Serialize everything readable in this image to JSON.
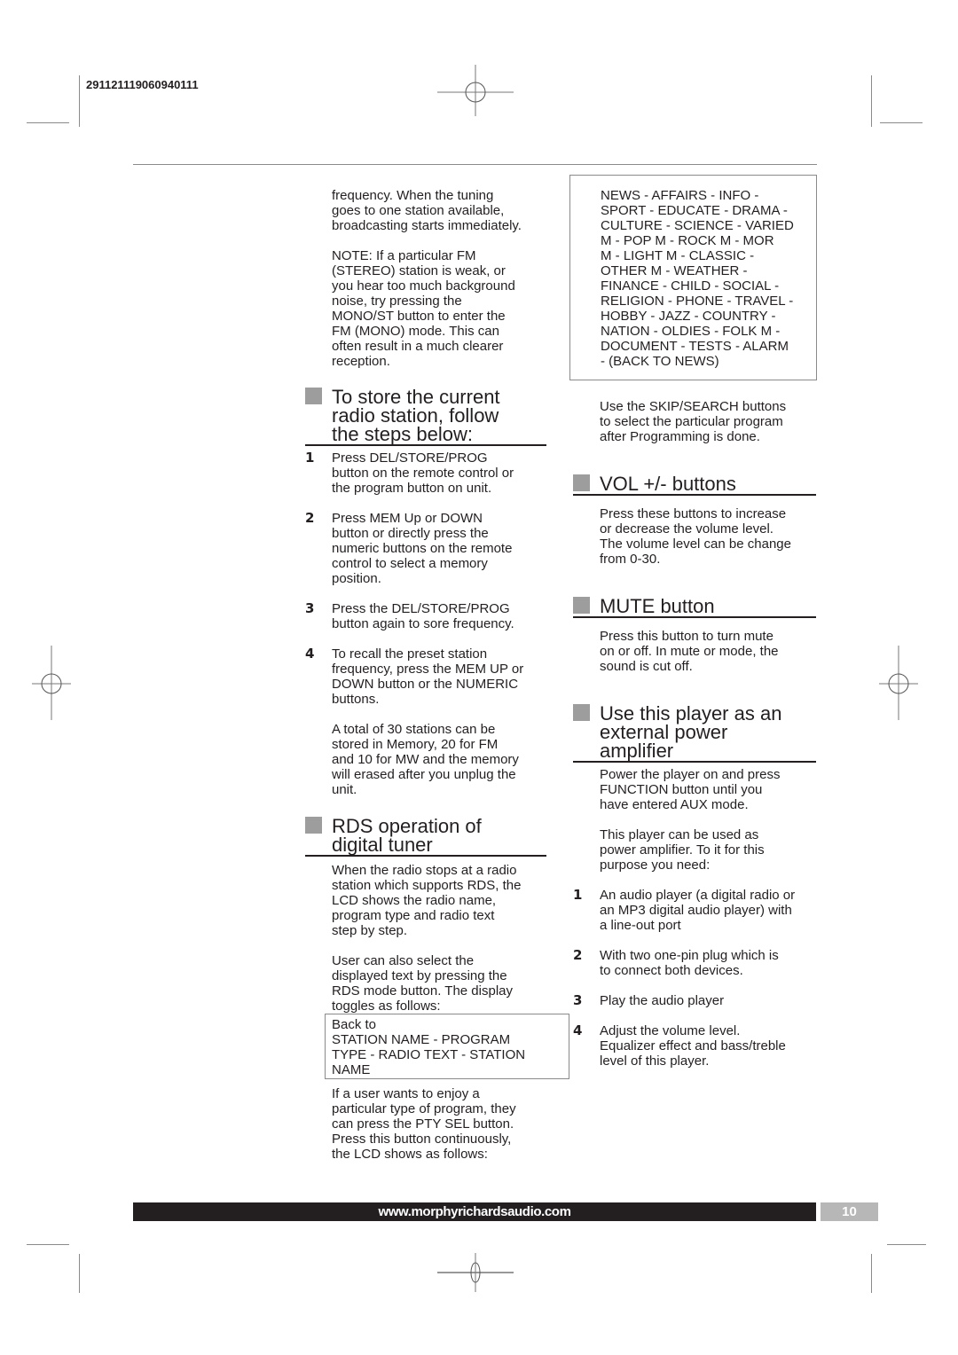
{
  "header": {
    "job_code": "291121119060940111"
  },
  "left_column": {
    "intro_paragraphs": [
      [
        "frequency. When the tuning",
        "goes to one station available,",
        "broadcasting starts immediately."
      ],
      [
        "NOTE: If a particular FM",
        "(STEREO) station is weak, or",
        "you hear too much background",
        "noise, try pressing the",
        "MONO/ST button to enter the",
        "FM (MONO) mode. This can",
        "often result in a much clearer",
        "reception."
      ]
    ],
    "store_section": {
      "heading": [
        "To store the current",
        "radio station, follow",
        "the steps below:"
      ],
      "steps": [
        {
          "num": "1",
          "lines": [
            "Press DEL/STORE/PROG",
            "button on the remote control or",
            "the program button on unit."
          ]
        },
        {
          "num": "2",
          "lines": [
            "Press MEM Up or DOWN",
            "button or directly press the",
            "numeric buttons on the remote",
            "control to select a memory",
            "position."
          ]
        },
        {
          "num": "3",
          "lines": [
            "Press the DEL/STORE/PROG",
            "button again to sore frequency."
          ]
        },
        {
          "num": "4",
          "lines": [
            "To recall the preset station",
            "frequency, press the MEM UP or",
            "DOWN button or the NUMERIC",
            "buttons."
          ]
        }
      ],
      "note": [
        "A total of 30 stations can be",
        "stored in Memory, 20 for FM",
        "and 10 for MW and the memory",
        "will erased after you unplug the",
        "unit."
      ]
    },
    "rds_section": {
      "heading": [
        "RDS operation of",
        "digital tuner"
      ],
      "paragraphs": [
        [
          "When the radio stops at a radio",
          "station which supports RDS, the",
          "LCD shows the radio name,",
          "program type and radio text",
          "step by step."
        ],
        [
          "User can also select the",
          "displayed text by pressing the",
          "RDS mode button. The display",
          "toggles as follows:"
        ]
      ],
      "toggle_box": [
        "Back to",
        "STATION NAME - PROGRAM",
        "TYPE - RADIO TEXT - STATION",
        "NAME"
      ],
      "pty_paragraph": [
        "If a user wants to enjoy a",
        "particular type of program, they",
        "can press the PTY SEL button.",
        "Press this button continuously,",
        "the LCD shows as follows:"
      ]
    }
  },
  "right_column": {
    "pty_box": [
      "NEWS - AFFAIRS - INFO -",
      "SPORT - EDUCATE - DRAMA -",
      "CULTURE - SCIENCE - VARIED",
      "M - POP M - ROCK M - MOR",
      "M - LIGHT M - CLASSIC -",
      "OTHER M - WEATHER -",
      "FINANCE - CHILD - SOCIAL -",
      "RELIGION - PHONE - TRAVEL -",
      "HOBBY - JAZZ - COUNTRY -",
      "NATION - OLDIES - FOLK M -",
      "DOCUMENT - TESTS - ALARM",
      "- (BACK TO NEWS)"
    ],
    "skip_paragraph": [
      "Use the SKIP/SEARCH buttons",
      "to select the particular program",
      "after Programming is done."
    ],
    "vol_section": {
      "heading": [
        "VOL +/- buttons"
      ],
      "paragraph": [
        "Press these buttons to increase",
        "or decrease the volume level.",
        "The volume level can be change",
        "from 0-30."
      ]
    },
    "mute_section": {
      "heading": [
        "MUTE button"
      ],
      "paragraph": [
        "Press this button to turn mute",
        "on or off. In mute or mode, the",
        "sound is cut off."
      ]
    },
    "amp_section": {
      "heading": [
        "Use this player as an",
        "external power",
        "amplifier"
      ],
      "paragraphs": [
        [
          "Power the player on and press",
          "FUNCTION button until you",
          "have entered AUX mode."
        ],
        [
          "This player can be used as",
          "power amplifier. To it for this",
          "purpose you need:"
        ]
      ],
      "steps": [
        {
          "num": "1",
          "lines": [
            "An audio player (a digital radio or",
            "an MP3 digital audio player) with",
            "a line-out port"
          ]
        },
        {
          "num": "2",
          "lines": [
            "With two one-pin plug which is",
            "to connect both devices."
          ]
        },
        {
          "num": "3",
          "lines": [
            "Play the audio player"
          ]
        },
        {
          "num": "4",
          "lines": [
            "Adjust the volume level.",
            "Equalizer effect and bass/treble",
            "level of this player."
          ]
        }
      ]
    }
  },
  "footer": {
    "website": "www.morphyrichardsaudio.com",
    "page_number": "10"
  },
  "colors": {
    "text": "#231f20",
    "bullet_gray": "#9d9d9d",
    "footer_bar": "#231f20",
    "page_box": "#b7b7b7",
    "rule_gray": "#8a8a8a"
  }
}
